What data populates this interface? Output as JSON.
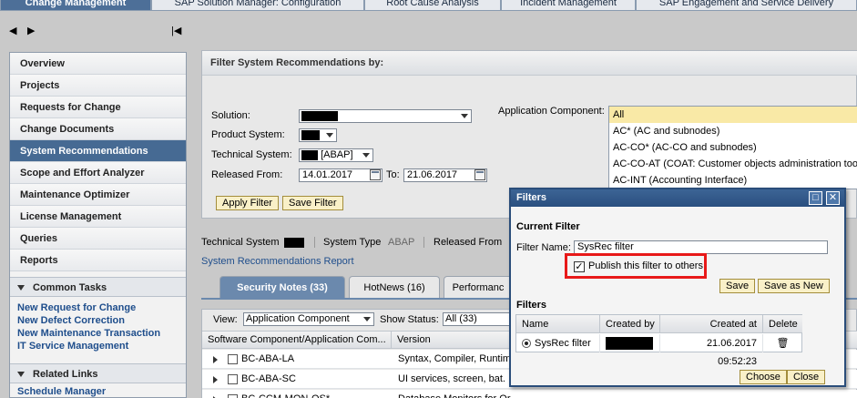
{
  "top_tabs": [
    {
      "label": "Change Management",
      "active": true
    },
    {
      "label": "SAP Solution Manager: Configuration",
      "active": false
    },
    {
      "label": "Root Cause Analysis",
      "active": false
    },
    {
      "label": "Incident Management",
      "active": false
    },
    {
      "label": "SAP Engagement and Service Delivery",
      "active": false
    }
  ],
  "nav": {
    "back": "◀",
    "forward": "▶",
    "collapse": "|◀"
  },
  "sidebar": {
    "items": [
      {
        "label": "Overview",
        "active": false
      },
      {
        "label": "Projects",
        "active": false
      },
      {
        "label": "Requests for Change",
        "active": false
      },
      {
        "label": "Change Documents",
        "active": false
      },
      {
        "label": "System Recommendations",
        "active": true
      },
      {
        "label": "Scope and Effort Analyzer",
        "active": false
      },
      {
        "label": "Maintenance Optimizer",
        "active": false
      },
      {
        "label": "License Management",
        "active": false
      },
      {
        "label": "Queries",
        "active": false
      },
      {
        "label": "Reports",
        "active": false
      }
    ],
    "common_tasks_title": "Common Tasks",
    "common_tasks": [
      "New Request for Change",
      "New Defect Correction",
      "New Maintenance Transaction",
      "IT Service Management"
    ],
    "related_links_title": "Related Links",
    "related_links": [
      "Schedule Manager"
    ]
  },
  "filter": {
    "title": "Filter System Recommendations by:",
    "solution_label": "Solution:",
    "product_system_label": "Product System:",
    "technical_system_label": "Technical System:",
    "technical_system_suffix": "[ABAP]",
    "released_from_label": "Released From:",
    "released_from": "14.01.2017",
    "to_label": "To:",
    "released_to": "21.06.2017",
    "apply_button": "Apply Filter",
    "save_button": "Save Filter",
    "app_component_label": "Application Component:",
    "app_components": [
      {
        "label": "All",
        "selected": true
      },
      {
        "label": "AC* (AC and subnodes)",
        "selected": false
      },
      {
        "label": "AC-CO* (AC-CO and subnodes)",
        "selected": false
      },
      {
        "label": "AC-CO-AT (COAT: Customer objects administration tool)",
        "selected": false
      },
      {
        "label": "AC-INT (Accounting Interface)",
        "selected": false
      }
    ]
  },
  "info": {
    "technical_system_label": "Technical System",
    "system_type_label": "System Type",
    "system_type_value": "ABAP",
    "released_from_label": "Released From",
    "report_link": "System Recommendations Report"
  },
  "tabs": [
    {
      "label": "Security Notes (33)",
      "active": true
    },
    {
      "label": "HotNews (16)",
      "active": false
    },
    {
      "label": "Performanc",
      "active": false
    }
  ],
  "table": {
    "view_label": "View:",
    "view_value": "Application Component",
    "status_label": "Show Status:",
    "status_value": "All (33)",
    "columns": [
      "Software Component/Application Com...",
      "Version"
    ],
    "rows": [
      {
        "component": "BC-ABA-LA",
        "version": "Syntax, Compiler, Runtim"
      },
      {
        "component": "BC-ABA-SC",
        "version": "UI services, screen, bat."
      },
      {
        "component": "BC-CCM-MON-OS*",
        "version": "Database Monitors for Or"
      }
    ]
  },
  "popup": {
    "title": "Filters",
    "current_filter_title": "Current Filter",
    "filter_name_label": "Filter Name:",
    "filter_name_value": "SysRec filter",
    "publish_label": "Publish this filter to others",
    "save_button": "Save",
    "save_as_new_button": "Save as New",
    "filters_title": "Filters",
    "columns": [
      "Name",
      "Created by",
      "Created at",
      "Delete"
    ],
    "rows": [
      {
        "name": "SysRec filter",
        "created_at": "21.06.2017 09:52:23"
      }
    ],
    "choose_button": "Choose",
    "close_button": "Close",
    "maximize_icon": "□",
    "close_icon": "✕",
    "trash_icon": "🗑"
  },
  "colors": {
    "accent": "#466a93",
    "highlight": "#e81919",
    "button_bg": "#f9f0c8"
  }
}
